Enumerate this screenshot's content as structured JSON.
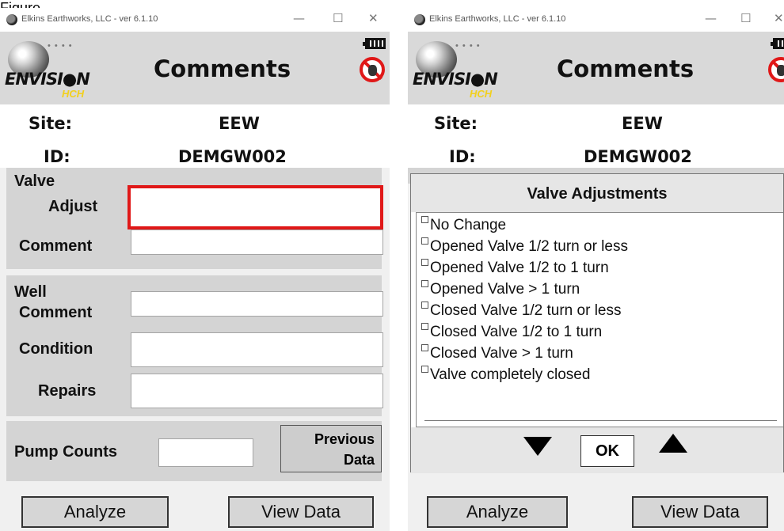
{
  "figure_label": "Figure",
  "window_title": "Elkins Earthworks, LLC - ver 6.1.10",
  "titlebar_controls": {
    "minimize": "—",
    "maximize": "☐",
    "close": "✕"
  },
  "header": {
    "title": "Comments",
    "logo_text": "ENVISI●N",
    "logo_sub": "HCH",
    "logo_dots": "• • • •"
  },
  "info": {
    "site_label": "Site:",
    "site_value": "EEW",
    "id_label": "ID:",
    "id_value": "DEMGW002"
  },
  "valve": {
    "label_line1": "Valve",
    "adjust_label": "Adjust",
    "comment_label": "Comment",
    "adjust_value": "",
    "comment_value": ""
  },
  "well": {
    "label_line1": "Well",
    "comment_label": "Comment",
    "condition_label": "Condition",
    "repairs_label": "Repairs",
    "comment_value": "",
    "condition_value": "",
    "repairs_value": ""
  },
  "pump": {
    "label": "Pump Counts",
    "value": "",
    "previous_line1": "Previous",
    "previous_line2": "Data"
  },
  "buttons": {
    "analyze": "Analyze",
    "view_data": "View Data"
  },
  "dialog": {
    "title": "Valve Adjustments",
    "options": [
      "No Change",
      "Opened Valve 1/2 turn or less",
      "Opened Valve 1/2 to 1 turn",
      "Opened Valve > 1 turn",
      "Closed Valve 1/2 turn or less",
      "Closed Valve 1/2 to 1 turn",
      "Closed Valve > 1 turn",
      "Valve completely closed"
    ],
    "ok": "OK"
  }
}
